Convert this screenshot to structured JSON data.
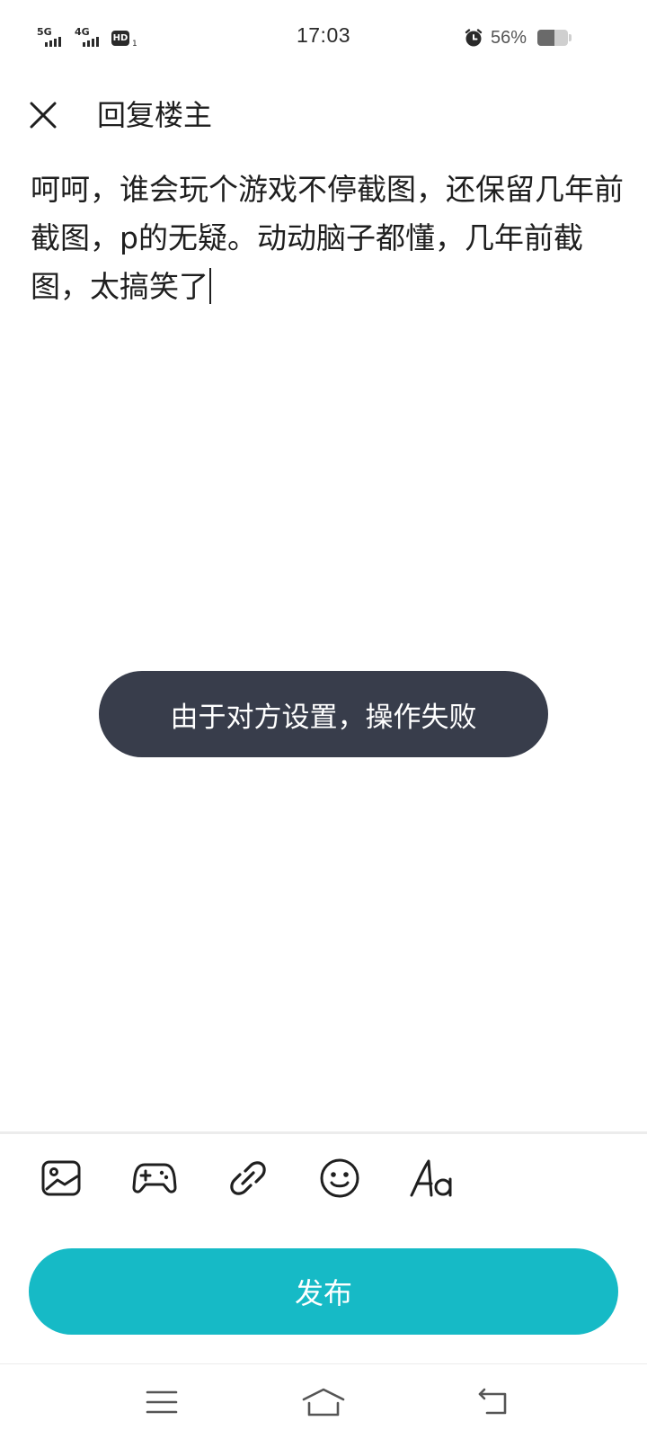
{
  "status_bar": {
    "sim1_network": "5G",
    "sim2_network": "4G",
    "hd_badge": "HD",
    "hd_sub": "1",
    "time": "17:03",
    "alarm_icon": "alarm-clock-icon",
    "battery_percent": "56%",
    "battery_level": 0.56
  },
  "header": {
    "close_icon": "close-icon",
    "title": "回复楼主"
  },
  "editor": {
    "text": "呵呵，谁会玩个游戏不停截图，还保留几年前截图，p的无疑。动动脑子都懂，几年前截图，太搞笑了"
  },
  "toast": {
    "message": "由于对方设置，操作失败"
  },
  "toolbar": {
    "items": [
      {
        "icon": "image-icon"
      },
      {
        "icon": "gamepad-icon"
      },
      {
        "icon": "link-icon"
      },
      {
        "icon": "emoji-icon"
      },
      {
        "icon": "font-format-icon",
        "label": "Aa"
      }
    ]
  },
  "publish": {
    "label": "发布",
    "color": "#16bac6"
  },
  "nav": {
    "menu_icon": "menu-icon",
    "home_icon": "home-icon",
    "back_icon": "back-icon"
  },
  "colors": {
    "toast_bg": "#383d4b",
    "text": "#1f1f1f"
  }
}
